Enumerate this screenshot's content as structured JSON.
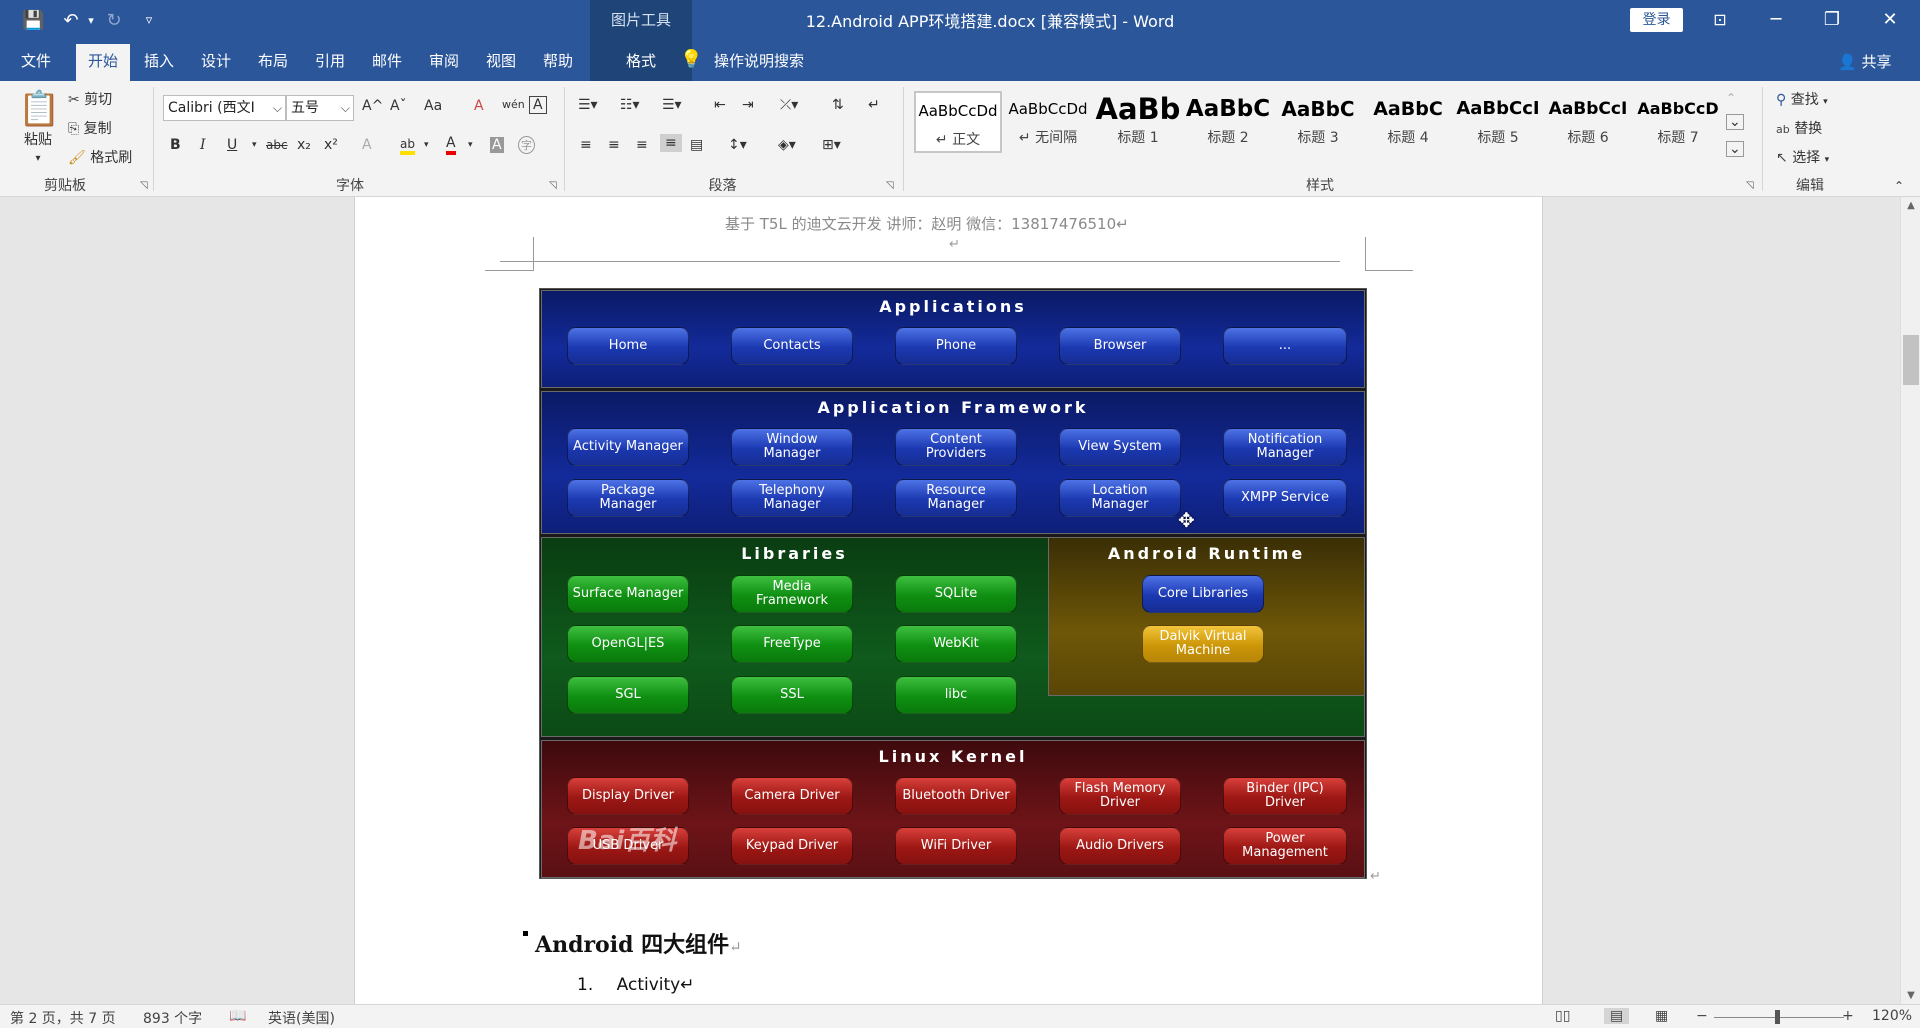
{
  "window": {
    "title": "12.Android APP环境搭建.docx [兼容模式]  -  Word",
    "picture_tools": "图片工具",
    "login": "登录",
    "minimize": "─",
    "restore": "❐",
    "close": "✕"
  },
  "qat": {
    "save": "💾",
    "undo": "↶",
    "undo_arrow": "▾",
    "redo": "↻",
    "customize": "▿"
  },
  "menu": {
    "tabs": [
      {
        "label": "文件"
      },
      {
        "label": "开始"
      },
      {
        "label": "插入"
      },
      {
        "label": "设计"
      },
      {
        "label": "布局"
      },
      {
        "label": "引用"
      },
      {
        "label": "邮件"
      },
      {
        "label": "审阅"
      },
      {
        "label": "视图"
      },
      {
        "label": "帮助"
      },
      {
        "label": "格式"
      }
    ],
    "search_help": "操作说明搜索",
    "share": "共享"
  },
  "ribbon": {
    "clipboard": {
      "paste": "粘贴",
      "cut": "剪切",
      "copy": "复制",
      "format_painter": "格式刷",
      "label": "剪贴板"
    },
    "font": {
      "family": "Calibri (西文I",
      "size": "五号",
      "label": "字体",
      "bold": "B",
      "italic": "I",
      "underline": "U",
      "strike": "abc",
      "subscript": "x₂",
      "superscript": "x²",
      "grow": "A^",
      "shrink": "Aˇ",
      "change_case": "Aa",
      "clear": "A",
      "pinyin": "wén",
      "border": "A",
      "effects": "A",
      "highlight": "ab",
      "color": "A",
      "shade": "A",
      "enclose": "字"
    },
    "paragraph": {
      "label": "段落"
    },
    "styles": {
      "label": "样式",
      "items": [
        {
          "sample": "AaBbCcDd",
          "name": "↵ 正文"
        },
        {
          "sample": "AaBbCcDd",
          "name": "↵ 无间隔"
        },
        {
          "sample": "AaBb",
          "name": "标题 1"
        },
        {
          "sample": "AaBbC",
          "name": "标题 2"
        },
        {
          "sample": "AaBbC",
          "name": "标题 3"
        },
        {
          "sample": "AaBbC",
          "name": "标题 4"
        },
        {
          "sample": "AaBbCcI",
          "name": "标题 5"
        },
        {
          "sample": "AaBbCcI",
          "name": "标题 6"
        },
        {
          "sample": "AaBbCcD",
          "name": "标题 7"
        }
      ]
    },
    "editing": {
      "find": "查找",
      "replace": "替换",
      "select": "选择",
      "label": "编辑"
    }
  },
  "document": {
    "header_text": "基于 T5L 的迪文云开发  讲师：赵明    微信：13817476510↵",
    "para_mark": "↵",
    "diagram": {
      "applications": {
        "title": "Applications",
        "items": [
          "Home",
          "Contacts",
          "Phone",
          "Browser",
          "..."
        ]
      },
      "framework": {
        "title": "Application Framework",
        "row1": [
          "Activity Manager",
          "Window Manager",
          "Content Providers",
          "View System",
          "Notification Manager"
        ],
        "row2": [
          "Package Manager",
          "Telephony Manager",
          "Resource Manager",
          "Location Manager",
          "XMPP Service"
        ]
      },
      "libraries": {
        "title": "Libraries",
        "row1": [
          "Surface Manager",
          "Media Framework",
          "SQLite"
        ],
        "row2": [
          "OpenGL|ES",
          "FreeType",
          "WebKit"
        ],
        "row3": [
          "SGL",
          "SSL",
          "libc"
        ]
      },
      "runtime": {
        "title": "Android Runtime",
        "items": [
          "Core Libraries",
          "Dalvik Virtual Machine"
        ]
      },
      "kernel": {
        "title": "Linux Kernel",
        "row1": [
          "Display Driver",
          "Camera Driver",
          "Bluetooth Driver",
          "Flash Memory Driver",
          "Binder (IPC) Driver"
        ],
        "row2": [
          "USB Driver",
          "Keypad Driver",
          "WiFi Driver",
          "Audio Drivers",
          "Power Management"
        ]
      },
      "watermark": "Bai百科"
    },
    "heading": "Android  四大组件",
    "list": [
      {
        "num": "1.",
        "text": "Activity↵"
      }
    ]
  },
  "status": {
    "page": "第 2 页，共 7 页",
    "words": "893 个字",
    "language": "英语(美国)",
    "zoom": "120%"
  }
}
